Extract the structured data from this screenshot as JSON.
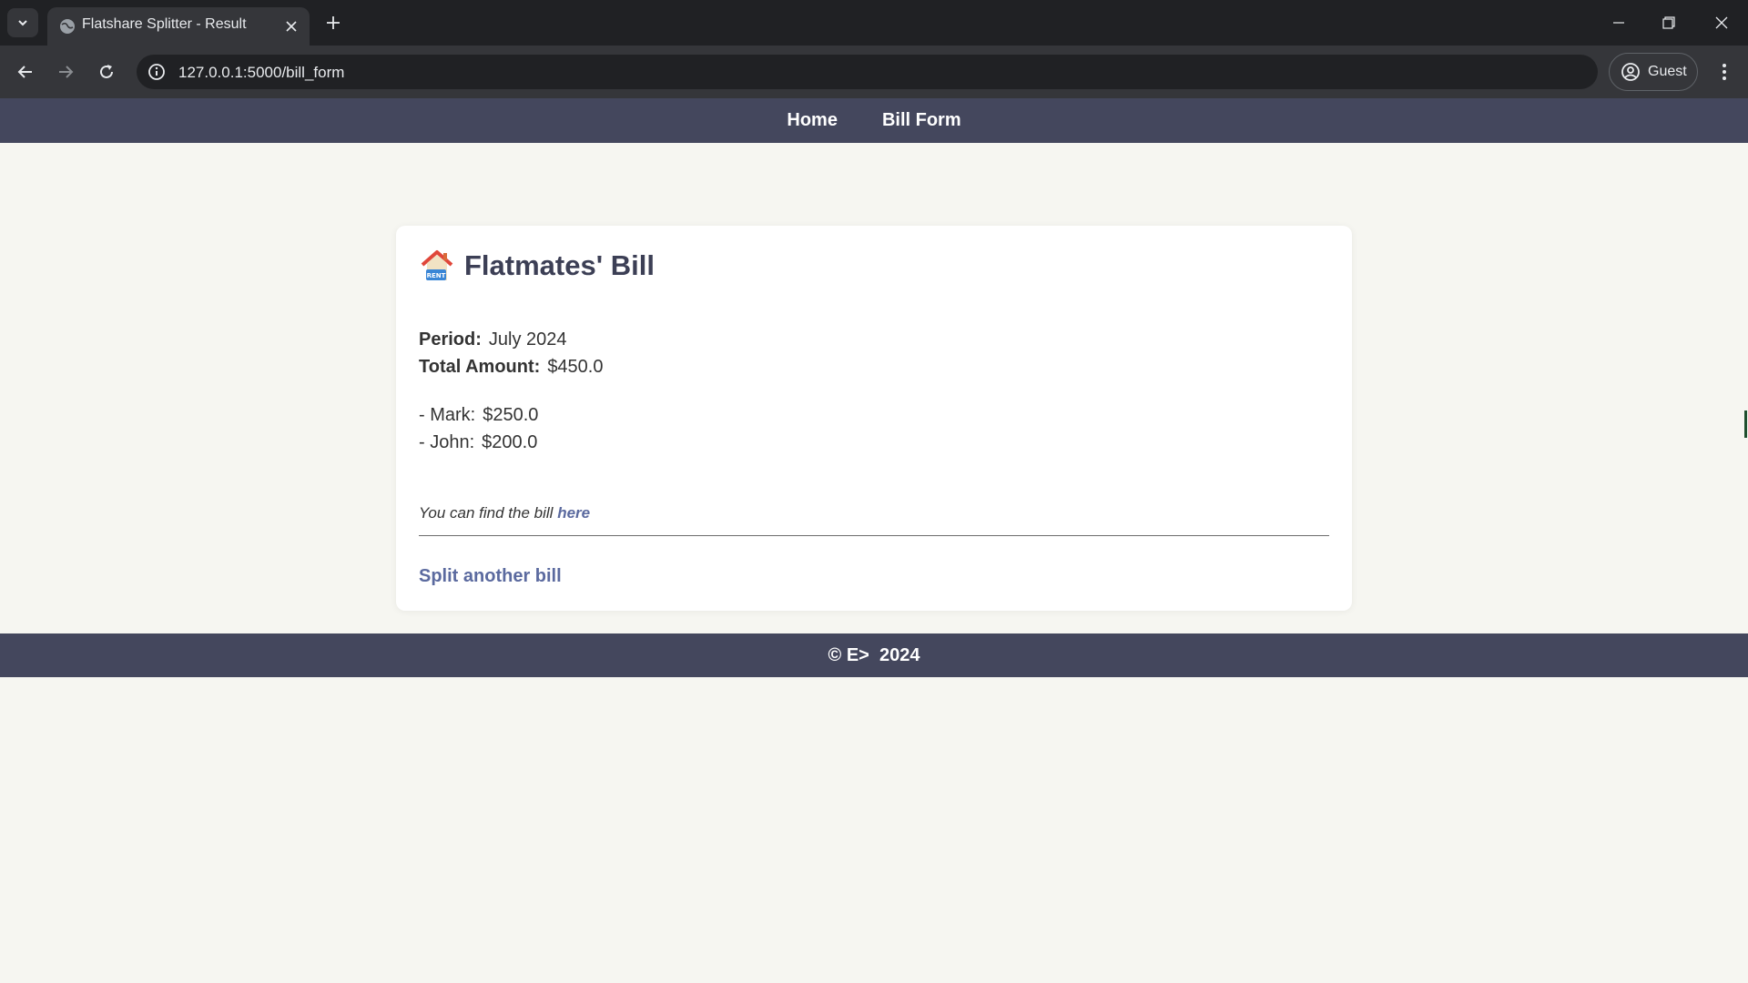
{
  "browser": {
    "tab_title": "Flatshare Splitter - Result",
    "url": "127.0.0.1:5000/bill_form",
    "profile_label": "Guest"
  },
  "nav": {
    "items": [
      {
        "label": "Home"
      },
      {
        "label": "Bill Form"
      }
    ]
  },
  "bill": {
    "icon": "house-with-rent-sign-icon",
    "title": "Flatmates' Bill",
    "period_label": "Period:",
    "period_value": "July 2024",
    "total_label": "Total Amount:",
    "total_value": "$450.0",
    "shares": [
      {
        "name": "- Mark:",
        "amount": "$250.0"
      },
      {
        "name": "- John:",
        "amount": "$200.0"
      }
    ],
    "note_text": "You can find the bill",
    "note_link": "here",
    "split_another_label": "Split another bill"
  },
  "footer": {
    "text": "© E>  2024"
  },
  "colors": {
    "nav_bg": "#44475d",
    "page_bg": "#f6f6f1",
    "link": "#5b6a9f",
    "title": "#3c3f55"
  }
}
